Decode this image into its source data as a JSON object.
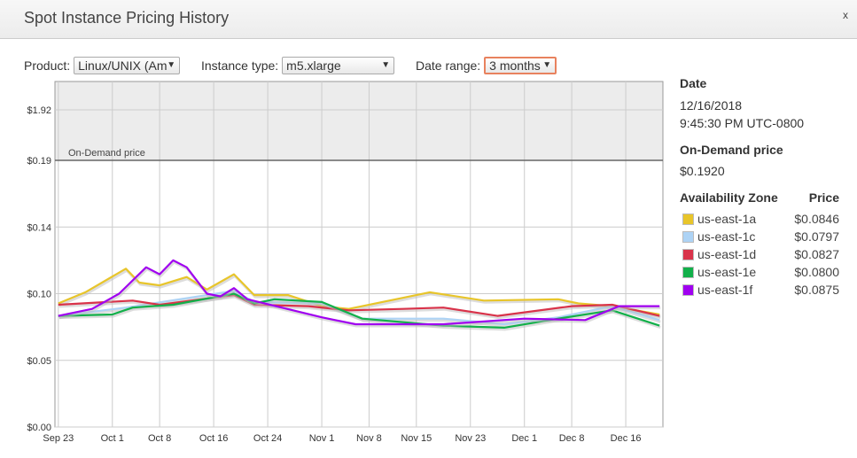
{
  "header": {
    "title": "Spot Instance Pricing History",
    "close_label": "x"
  },
  "controls": {
    "product": {
      "label": "Product:",
      "value": "Linux/UNIX (Am"
    },
    "instance_type": {
      "label": "Instance type:",
      "value": "m5.xlarge"
    },
    "date_range": {
      "label": "Date range:",
      "value": "3 months"
    }
  },
  "details": {
    "date_heading": "Date",
    "date": "12/16/2018",
    "time": "9:45:30 PM UTC-0800",
    "ondemand_heading": "On-Demand price",
    "ondemand_price": "$0.1920",
    "az_heading": "Availability Zone",
    "price_heading": "Price",
    "zones": [
      {
        "name": "us-east-1a",
        "price": "$0.0846",
        "color": "#e8c52a"
      },
      {
        "name": "us-east-1c",
        "price": "$0.0797",
        "color": "#add3f5"
      },
      {
        "name": "us-east-1d",
        "price": "$0.0827",
        "color": "#d9334a"
      },
      {
        "name": "us-east-1e",
        "price": "$0.0800",
        "color": "#12b04a"
      },
      {
        "name": "us-east-1f",
        "price": "$0.0875",
        "color": "#a000f0"
      }
    ]
  },
  "chart_data": {
    "type": "line",
    "xlim": [
      "2018-09-22T12:00",
      "2018-12-21T12:00"
    ],
    "x_ticks": [
      [
        "2018-09-23",
        "Sep 23"
      ],
      [
        "2018-10-01",
        "Oct 1"
      ],
      [
        "2018-10-08",
        "Oct 8"
      ],
      [
        "2018-10-16",
        "Oct 16"
      ],
      [
        "2018-10-24",
        "Oct 24"
      ],
      [
        "2018-11-01",
        "Nov 1"
      ],
      [
        "2018-11-08",
        "Nov 8"
      ],
      [
        "2018-11-15",
        "Nov 15"
      ],
      [
        "2018-11-23",
        "Nov 23"
      ],
      [
        "2018-12-01",
        "Dec 1"
      ],
      [
        "2018-12-08",
        "Dec 8"
      ],
      [
        "2018-12-16",
        "Dec 16"
      ]
    ],
    "y_ticks": [
      [
        0,
        "$0.00"
      ],
      [
        0.048,
        "$0.05"
      ],
      [
        0.096,
        "$0.10"
      ],
      [
        0.144,
        "$0.14"
      ],
      [
        0.192,
        "$0.19"
      ],
      [
        1.92,
        "$1.92"
      ]
    ],
    "grid": true,
    "ondemand": {
      "value": 0.192,
      "label": "On-Demand price"
    },
    "series": [
      {
        "name": "us-east-1a",
        "color": "#e8c52a",
        "points": [
          [
            "2018-09-23",
            0.089
          ],
          [
            "2018-09-27",
            0.097
          ],
          [
            "2018-10-03",
            0.114
          ],
          [
            "2018-10-05",
            0.104
          ],
          [
            "2018-10-08",
            0.102
          ],
          [
            "2018-10-12",
            0.108
          ],
          [
            "2018-10-15",
            0.099
          ],
          [
            "2018-10-19",
            0.11
          ],
          [
            "2018-10-22",
            0.095
          ],
          [
            "2018-10-27",
            0.095
          ],
          [
            "2018-11-01",
            0.087
          ],
          [
            "2018-11-05",
            0.085
          ],
          [
            "2018-11-17",
            0.097
          ],
          [
            "2018-11-25",
            0.091
          ],
          [
            "2018-12-06",
            0.092
          ],
          [
            "2018-12-09",
            0.089
          ],
          [
            "2018-12-14",
            0.087
          ],
          [
            "2018-12-21",
            0.081
          ]
        ]
      },
      {
        "name": "us-east-1c",
        "color": "#add3f5",
        "points": [
          [
            "2018-09-23",
            0.08
          ],
          [
            "2018-10-03",
            0.086
          ],
          [
            "2018-10-19",
            0.098
          ],
          [
            "2018-10-22",
            0.09
          ],
          [
            "2018-11-01",
            0.089
          ],
          [
            "2018-11-07",
            0.078
          ],
          [
            "2018-11-19",
            0.078
          ],
          [
            "2018-11-28",
            0.074
          ],
          [
            "2018-12-06",
            0.079
          ],
          [
            "2018-12-14",
            0.087
          ],
          [
            "2018-12-21",
            0.077
          ]
        ]
      },
      {
        "name": "us-east-1d",
        "color": "#d9334a",
        "points": [
          [
            "2018-09-23",
            0.088
          ],
          [
            "2018-10-04",
            0.091
          ],
          [
            "2018-10-08",
            0.088
          ],
          [
            "2018-10-19",
            0.095
          ],
          [
            "2018-10-22",
            0.088
          ],
          [
            "2018-10-30",
            0.087
          ],
          [
            "2018-11-05",
            0.084
          ],
          [
            "2018-11-13",
            0.085
          ],
          [
            "2018-11-19",
            0.086
          ],
          [
            "2018-11-27",
            0.08
          ],
          [
            "2018-12-08",
            0.087
          ],
          [
            "2018-12-14",
            0.088
          ],
          [
            "2018-12-21",
            0.08
          ]
        ]
      },
      {
        "name": "us-east-1e",
        "color": "#12b04a",
        "points": [
          [
            "2018-09-23",
            0.08
          ],
          [
            "2018-10-01",
            0.081
          ],
          [
            "2018-10-04",
            0.086
          ],
          [
            "2018-10-10",
            0.088
          ],
          [
            "2018-10-19",
            0.096
          ],
          [
            "2018-10-22",
            0.089
          ],
          [
            "2018-10-25",
            0.092
          ],
          [
            "2018-11-01",
            0.09
          ],
          [
            "2018-11-07",
            0.078
          ],
          [
            "2018-11-19",
            0.073
          ],
          [
            "2018-11-28",
            0.0715
          ],
          [
            "2018-12-06",
            0.078
          ],
          [
            "2018-12-14",
            0.084
          ],
          [
            "2018-12-21",
            0.073
          ]
        ]
      },
      {
        "name": "us-east-1f",
        "color": "#a000f0",
        "points": [
          [
            "2018-09-23",
            0.08
          ],
          [
            "2018-09-28",
            0.085
          ],
          [
            "2018-10-02",
            0.096
          ],
          [
            "2018-10-06",
            0.115
          ],
          [
            "2018-10-08",
            0.11
          ],
          [
            "2018-10-10",
            0.12
          ],
          [
            "2018-10-12",
            0.115
          ],
          [
            "2018-10-15",
            0.096
          ],
          [
            "2018-10-17",
            0.094
          ],
          [
            "2018-10-19",
            0.1
          ],
          [
            "2018-10-21",
            0.092
          ],
          [
            "2018-11-01",
            0.079
          ],
          [
            "2018-11-06",
            0.074
          ],
          [
            "2018-11-19",
            0.074
          ],
          [
            "2018-12-01",
            0.078
          ],
          [
            "2018-12-10",
            0.077
          ],
          [
            "2018-12-15",
            0.087
          ],
          [
            "2018-12-21",
            0.087
          ]
        ]
      }
    ]
  }
}
